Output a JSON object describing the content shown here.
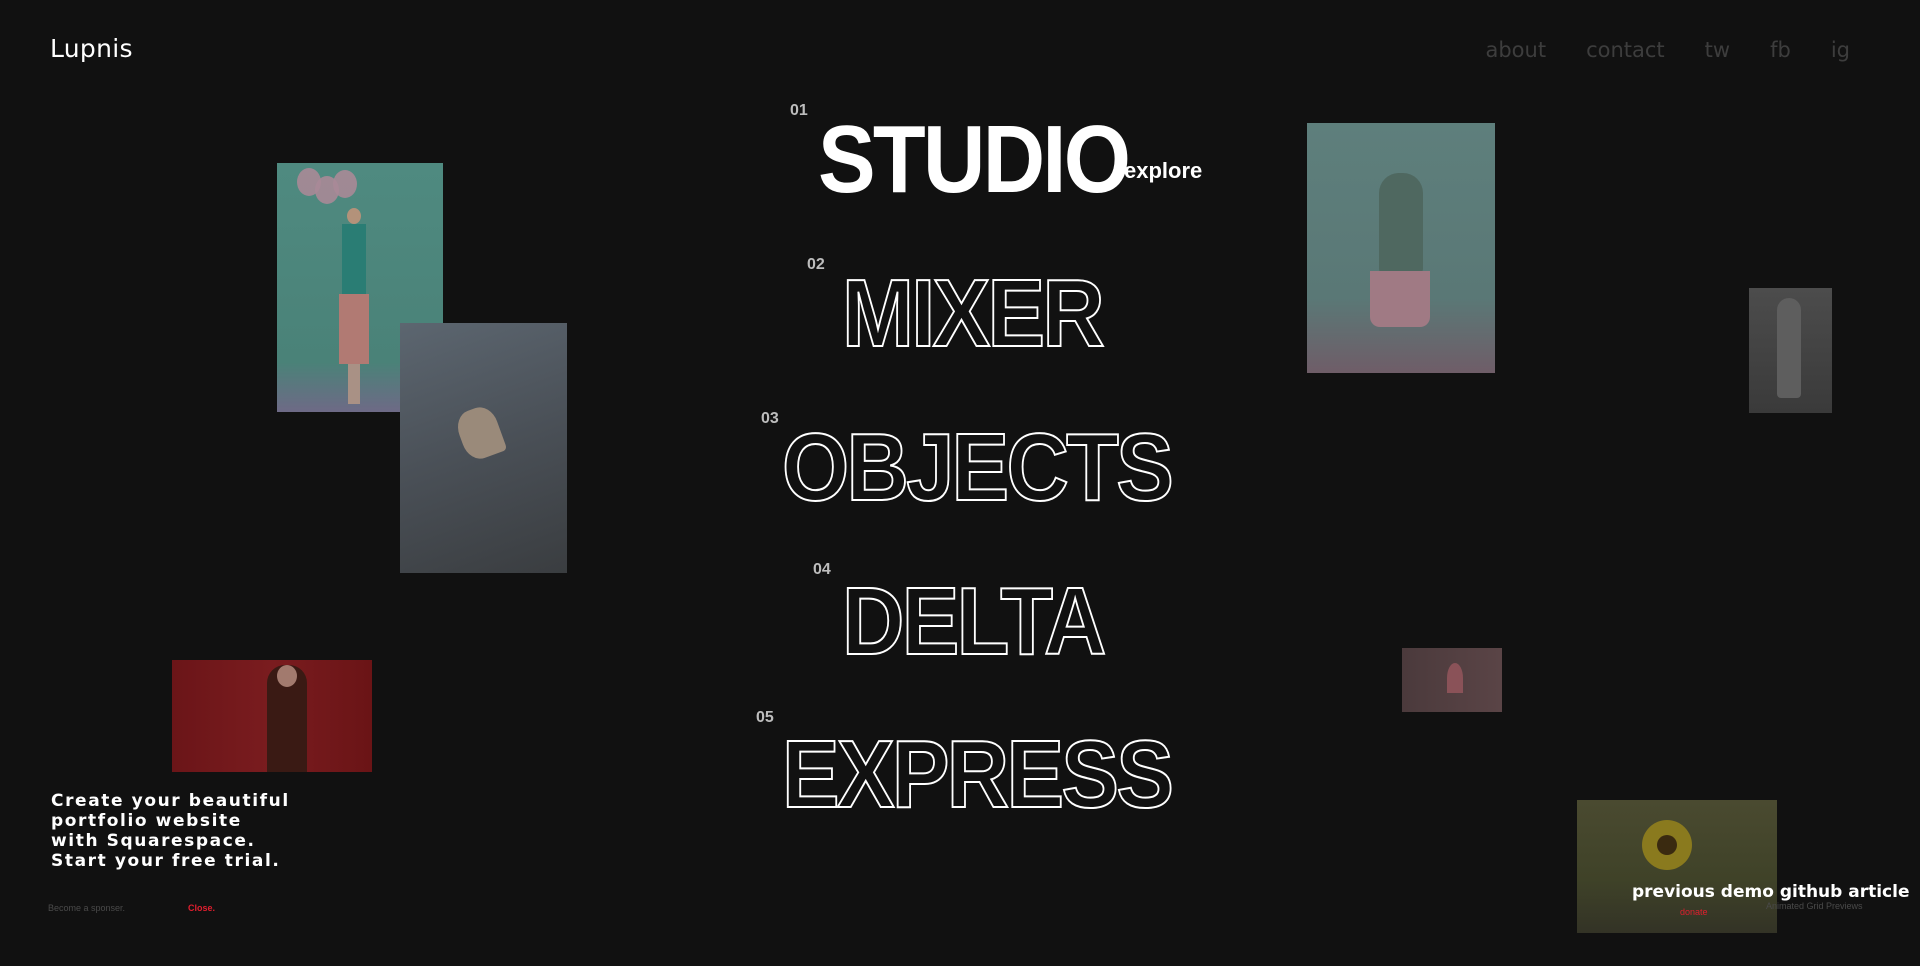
{
  "header": {
    "logo": "Lupnis",
    "nav": [
      "about",
      "contact",
      "tw",
      "fb",
      "ig"
    ]
  },
  "menu": [
    {
      "num": "01",
      "label": "STUDIO"
    },
    {
      "num": "02",
      "label": "MIXER"
    },
    {
      "num": "03",
      "label": "OBJECTS"
    },
    {
      "num": "04",
      "label": "DELTA"
    },
    {
      "num": "05",
      "label": "EXPRESS"
    }
  ],
  "explore_label": "explore",
  "promo": {
    "text": "Create your beautiful portfolio website with Squarespace. Start your free trial.",
    "sponsor": "Become a sponser.",
    "close": "Close."
  },
  "footer_links": {
    "previous_demo": "previous demo",
    "github": "github",
    "article": "article",
    "sub": "Animated Grid Previews",
    "donate": "donate"
  },
  "colors": {
    "background": "#111111",
    "accent_red": "#e01e2e",
    "nav_text": "#3d3d3d"
  }
}
